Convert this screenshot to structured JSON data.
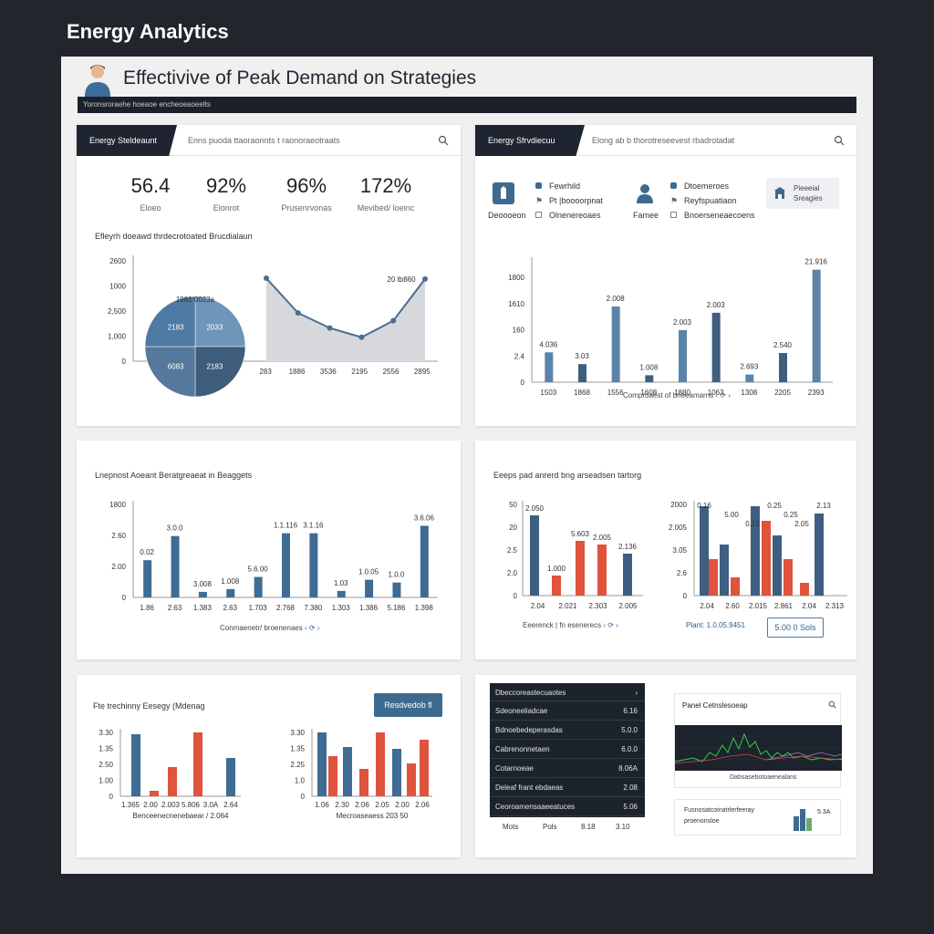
{
  "app": {
    "title": "Energy Analytics"
  },
  "header": {
    "title": "Effectivive of Peak Demand on Strategies",
    "subbar": "Yoronsroraehe hoeaoe encheoeaoeelts"
  },
  "card1": {
    "tab_label": "Energy Steldeaunt",
    "search_text": "Enns puoda ttaoraonnts t raonoraeotraats",
    "stats": [
      {
        "value": "56.4",
        "label": "Eloeo"
      },
      {
        "value": "92%",
        "label": "Elonrot"
      },
      {
        "value": "96%",
        "label": "Prusenrvonas"
      },
      {
        "value": "172%",
        "label": "Mevibed/ loeinc"
      }
    ],
    "subtitle": "Efleyrh doeawd thrdecrotoated Brucdialaun",
    "chart_data": {
      "type": "area",
      "y_ticks": [
        "2600",
        "1000",
        "2,500",
        "1,000",
        "0"
      ],
      "categories": [
        "283",
        "1886",
        "3536",
        "2195",
        "2556",
        "2895"
      ],
      "values": [
        2150,
        1250,
        860,
        620,
        1050,
        2130
      ],
      "pie": {
        "title": "1981 0023a",
        "slices": [
          {
            "label": "2033",
            "value": 25,
            "color": "#6f95b8"
          },
          {
            "label": "2183",
            "value": 25,
            "color": "#3e5c7c"
          },
          {
            "label": "6083",
            "value": 25,
            "color": "#55799c"
          },
          {
            "label": "2183",
            "value": 25,
            "color": "#4f7aa3"
          }
        ]
      },
      "annotation": "20 tb860"
    }
  },
  "card2": {
    "tab_label": "Energy Sfrvdiecuu",
    "search_text": "Elong ab b thorotreseevest rbadrotadat",
    "legend": [
      {
        "icon": "battery-icon",
        "label": "Deoooeon"
      },
      {
        "icon": "dot-icon",
        "label": "Fewrhild"
      },
      {
        "icon": "flag-icon",
        "label": "Pt |boooorpnat"
      },
      {
        "icon": "box-icon",
        "label": "Olnenereoaes"
      },
      {
        "icon": "person-icon",
        "label": "Famee"
      },
      {
        "icon": "dot-icon",
        "label": "Dtoemeroes"
      },
      {
        "icon": "flag-icon",
        "label": "Reyfspuatiaon"
      },
      {
        "icon": "box-icon",
        "label": "Bnoerseneaecoens"
      }
    ],
    "action_label": "Pieeeial Sreagies",
    "chart_data": {
      "type": "bar",
      "y_ticks": [
        "1800",
        "1610",
        "160",
        "2.4",
        "0"
      ],
      "categories": [
        "1503",
        "1868",
        "1556",
        "1608",
        "1880",
        "1063",
        "1308",
        "2205",
        "2393"
      ],
      "values": [
        430,
        260,
        1090,
        100,
        750,
        1000,
        110,
        420,
        1620
      ],
      "labels": [
        "4.036",
        "3.03",
        "2.008",
        "1.008",
        "2.003",
        "2.003",
        "2.693",
        "2.540",
        "21.916"
      ],
      "ylim": [
        0,
        1800
      ]
    },
    "caption": "Comproaest of bneeamarns"
  },
  "card3": {
    "subtitle": "Lnepnost Aoeant Beratgreaeat in Beaggets",
    "chart_data": {
      "type": "bar",
      "y_ticks": [
        "1800",
        "2.60",
        "2.00",
        "0"
      ],
      "categories": [
        "1.86",
        "2.63",
        "1.383",
        "2.63",
        "1.703",
        "2.768",
        "7.380",
        "1.303",
        "1.386",
        "5.186",
        "1.398"
      ],
      "values": [
        400,
        660,
        60,
        90,
        220,
        690,
        690,
        70,
        190,
        160,
        770
      ],
      "labels": [
        "0.02",
        "3.0.0",
        "3.008",
        "1.008",
        "5.6.00",
        "1.1.116",
        "3.1.16",
        "1.03",
        "1.0.05",
        "1.0.0",
        "3.6.06"
      ],
      "ylim": [
        0,
        1000
      ]
    },
    "caption": "Conmaenetr/ broenenaes"
  },
  "card4": {
    "subtitle": "Eeeps pad anrerd bng arseadsen tartorg",
    "chart_left": {
      "type": "bar",
      "y_ticks": [
        "50",
        "20",
        "2.5",
        "2.0",
        "0"
      ],
      "categories": [
        "2.04",
        "2.021",
        "2.303",
        "2.005"
      ],
      "series": [
        {
          "color": "#3e5f82",
          "values": [
            80,
            35,
            0,
            0
          ]
        },
        {
          "color": "#e0533c",
          "values": [
            0,
            0,
            60,
            55
          ]
        }
      ],
      "labels": [
        "2.050",
        "1.000",
        "5.603",
        "2.005",
        "2.136"
      ]
    },
    "chart_right": {
      "type": "bar",
      "y_ticks": [
        "2000",
        "2.005",
        "3.05",
        "2.6",
        "0"
      ],
      "categories": [
        "2.04",
        "2.60",
        "2.015",
        "2.861",
        "2.04",
        "2.313"
      ],
      "labels": [
        "0.16",
        "5.00",
        "0.15",
        "0.25",
        "0.25",
        "2.05",
        "2.13"
      ]
    },
    "caption": "Eeerenck | fn esenerecs",
    "footer_text": "Plant: 1.0.05.9451",
    "button_label": "5.00 0 Sols"
  },
  "card5": {
    "subtitle": "Fte trechinny Eesegy (Mdenag",
    "button_label": "Resdvedob fl",
    "chart_left": {
      "y_ticks": [
        "3.30",
        "1.35",
        "2.50",
        "1.00",
        "0"
      ],
      "categories": [
        "1.365",
        "2.00",
        "2.003",
        "5.806",
        "3.0A",
        "2.64"
      ],
      "caption": "Benceenecnenebaear / 2.064"
    },
    "chart_right": {
      "y_ticks": [
        "3.30",
        "1.35",
        "2.25",
        "1.0",
        "0"
      ],
      "categories": [
        "1.06",
        "2.30",
        "2.06",
        "2.05",
        "2.00",
        "2.06"
      ],
      "caption": "Mecroaseaess 203 50"
    }
  },
  "card6": {
    "table_header": "Dbeccoreastecuaotes",
    "rows": [
      {
        "label": "Sdeoneeliadcae",
        "value": "6.16"
      },
      {
        "label": "Bdnoebedeperasdas",
        "value": "5.0.0"
      },
      {
        "label": "Cabrenonnetaen",
        "value": "6.0.0"
      },
      {
        "label": "Cotarnoeae",
        "value": "8.06A"
      },
      {
        "label": "Deleaf frant ebdaeas",
        "value": "2.08"
      },
      {
        "label": "Ceoroamensaaeeatuces",
        "value": "5.06"
      }
    ],
    "table_footer": [
      "Mots",
      "Pols",
      "8.18",
      "3.10"
    ],
    "mini1_title": "Panel Cetnslesoeap",
    "mini1_caption": "Dabsasebotoaenealans",
    "mini2_title": "Fusnosatcoinatrlerfeeray",
    "mini2_sub": "proenonsloe",
    "mini2_value": "5.3A"
  }
}
